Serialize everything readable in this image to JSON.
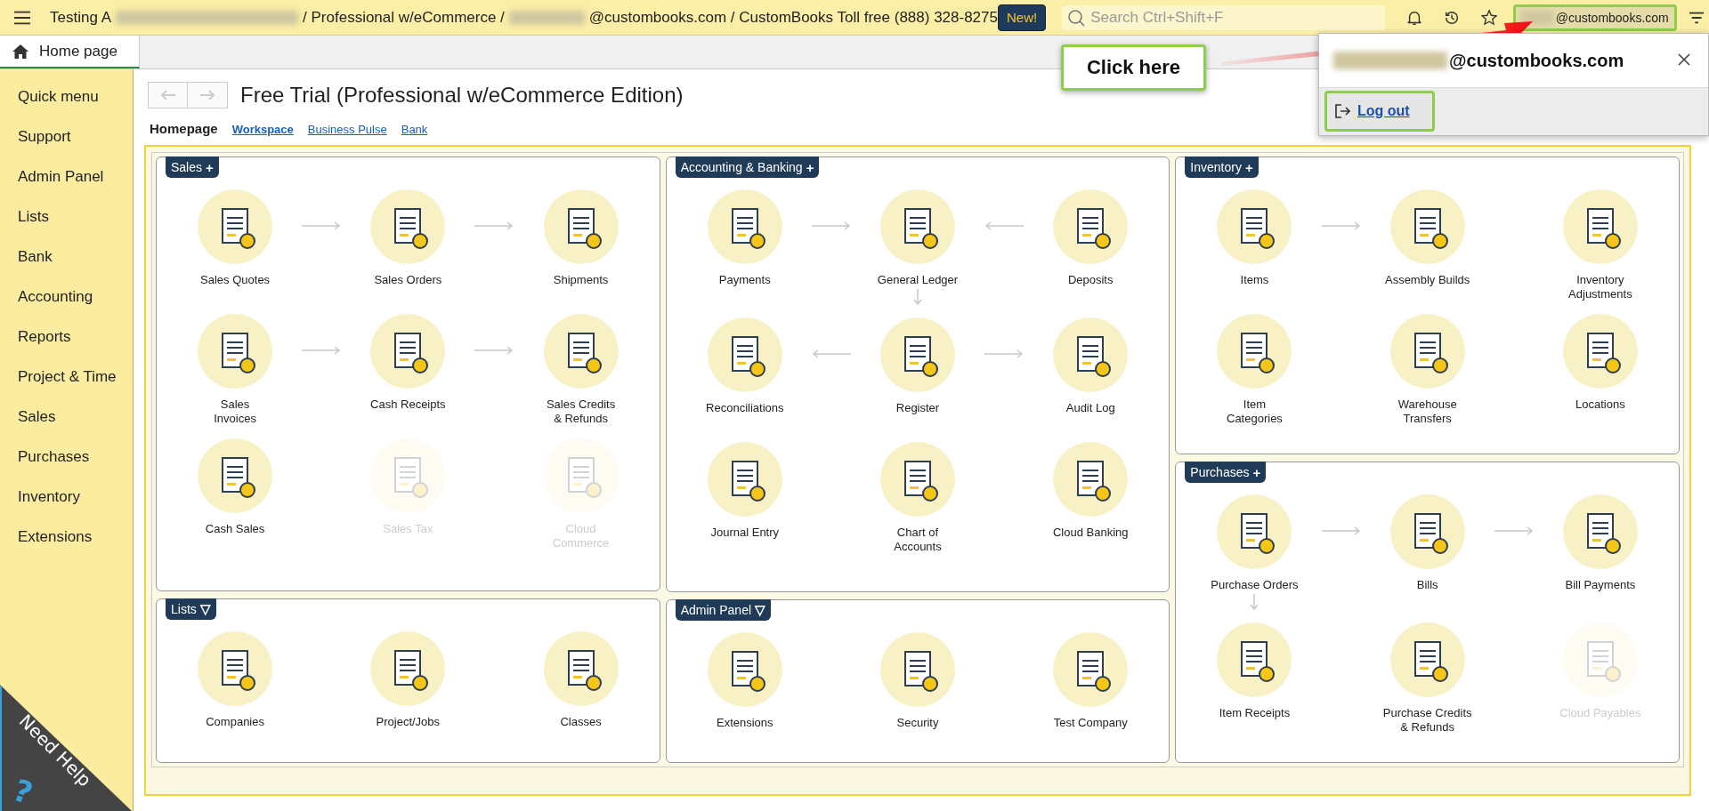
{
  "top_bar": {
    "title_parts": [
      {
        "kind": "text",
        "text": "Testing A"
      },
      {
        "kind": "redacted"
      },
      {
        "kind": "text",
        "text": "/ Professional w/eCommerce /"
      },
      {
        "kind": "redacted"
      },
      {
        "kind": "text",
        "text": "@custombooks.com / CustomBooks Toll free (888) 328-8275"
      }
    ],
    "new_button": "New!",
    "search": {
      "placeholder": "Search Ctrl+Shift+F"
    },
    "user": {
      "email_domain": "@custombooks.com"
    }
  },
  "user_menu": {
    "email_domain": "@custombooks.com",
    "logout": "Log out"
  },
  "annotation": {
    "callout": "Click here"
  },
  "tabs": [
    {
      "label": "Home page",
      "selected": true
    }
  ],
  "sidebar": {
    "items": [
      "Quick menu",
      "Support",
      "Admin Panel",
      "Lists",
      "Bank",
      "Accounting",
      "Reports",
      "Project & Time",
      "Sales",
      "Purchases",
      "Inventory",
      "Extensions"
    ],
    "help": {
      "label": "Need Help",
      "glyph": "?"
    }
  },
  "page": {
    "title": "Free Trial (Professional w/eCommerce Edition)",
    "views": [
      {
        "label": "Homepage",
        "selected": true,
        "bold": true
      },
      {
        "label": "Workspace",
        "selected": false,
        "bold": true
      },
      {
        "label": "Business Pulse",
        "selected": false,
        "bold": false
      },
      {
        "label": "Bank",
        "selected": false,
        "bold": false
      }
    ]
  },
  "columns": [
    {
      "panels": [
        {
          "title": "Sales",
          "toggle": "+",
          "tiles": [
            {
              "label": "Sales Quotes",
              "disabled": false,
              "arrow_right": true
            },
            {
              "label": "Sales Orders",
              "disabled": false,
              "arrow_right": true
            },
            {
              "label": "Shipments",
              "disabled": false
            },
            {
              "label": "Sales\nInvoices",
              "disabled": false,
              "arrow_right": true
            },
            {
              "label": "Cash Receipts",
              "disabled": false,
              "arrow_right": true
            },
            {
              "label": "Sales Credits\n& Refunds",
              "disabled": false
            },
            {
              "label": "Cash Sales",
              "disabled": false
            },
            {
              "label": "Sales Tax",
              "disabled": true
            },
            {
              "label": "Cloud\nCommerce",
              "disabled": true
            }
          ]
        },
        {
          "title": "Lists",
          "toggle": "▽",
          "tiles": [
            {
              "label": "Companies",
              "disabled": false
            },
            {
              "label": "Project/Jobs",
              "disabled": false
            },
            {
              "label": "Classes",
              "disabled": false
            }
          ]
        }
      ]
    },
    {
      "panels": [
        {
          "title": "Accounting & Banking",
          "toggle": "+",
          "tiles": [
            {
              "label": "Payments",
              "disabled": false,
              "arrow_right": true
            },
            {
              "label": "General Ledger",
              "disabled": false,
              "arrow_left": true,
              "arrow_down": true
            },
            {
              "label": "Deposits",
              "disabled": false
            },
            {
              "label": "Reconciliations",
              "disabled": false,
              "arrow_left": true
            },
            {
              "label": "Register",
              "disabled": false,
              "arrow_right": true
            },
            {
              "label": "Audit Log",
              "disabled": false
            },
            {
              "label": "Journal Entry",
              "disabled": false
            },
            {
              "label": "Chart of\nAccounts",
              "disabled": false
            },
            {
              "label": "Cloud Banking",
              "disabled": false
            }
          ]
        },
        {
          "title": "Admin Panel",
          "toggle": "▽",
          "tiles": [
            {
              "label": "Extensions",
              "disabled": false
            },
            {
              "label": "Security",
              "disabled": false
            },
            {
              "label": "Test Company",
              "disabled": false
            }
          ]
        }
      ]
    },
    {
      "panels": [
        {
          "title": "Inventory",
          "toggle": "+",
          "tiles": [
            {
              "label": "Items",
              "disabled": false,
              "arrow_right": true
            },
            {
              "label": "Assembly Builds",
              "disabled": false
            },
            {
              "label": "Inventory\nAdjustments",
              "disabled": false
            },
            {
              "label": "Item\nCategories",
              "disabled": false
            },
            {
              "label": "Warehouse\nTransfers",
              "disabled": false
            },
            {
              "label": "Locations",
              "disabled": false
            }
          ]
        },
        {
          "title": "Purchases",
          "toggle": "+",
          "tiles": [
            {
              "label": "Purchase Orders",
              "disabled": false,
              "arrow_right": true,
              "arrow_down": true
            },
            {
              "label": "Bills",
              "disabled": false,
              "arrow_right": true
            },
            {
              "label": "Bill Payments",
              "disabled": false
            },
            {
              "label": "Item Receipts",
              "disabled": false
            },
            {
              "label": "Purchase Credits\n& Refunds",
              "disabled": false
            },
            {
              "label": "Cloud Payables",
              "disabled": true
            }
          ]
        }
      ]
    }
  ]
}
